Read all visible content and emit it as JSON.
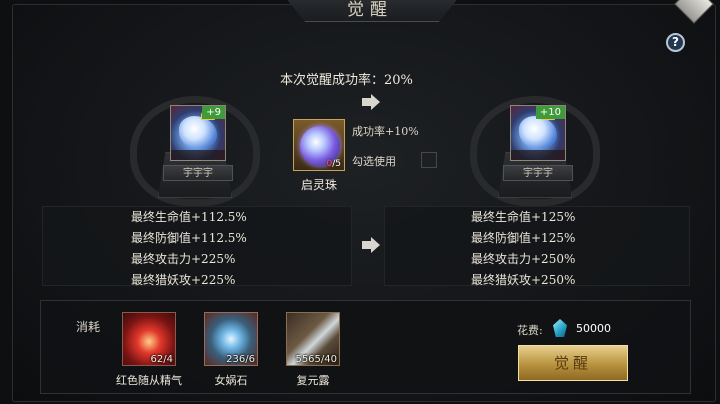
{
  "header": {
    "title": "觉醒",
    "help_icon": "question-icon",
    "help_label": "?"
  },
  "left_hero": {
    "name": "宇宇宇",
    "level_badge": "+9",
    "icon": "dragon-portrait-icon"
  },
  "right_hero": {
    "name": "宇宇宇",
    "level_badge": "+10",
    "icon": "dragon-portrait-icon"
  },
  "middle": {
    "success_rate": "本次觉醒成功率：20%",
    "item": {
      "name": "启灵珠",
      "count_owned": "0",
      "count_sep": "/5",
      "icon": "spirit-orb-icon"
    },
    "bonus": "成功率+10%",
    "use_checkbox_label": "勾选使用",
    "use_checked": false
  },
  "stats_before": [
    "最终生命值+112.5%",
    "最终防御值+112.5%",
    "最终攻击力+225%",
    "最终猎妖攻+225%"
  ],
  "stats_after": [
    "最终生命值+125%",
    "最终防御值+125%",
    "最终攻击力+250%",
    "最终猎妖攻+250%"
  ],
  "consume": {
    "label": "消耗",
    "materials": [
      {
        "name": "红色随从精气",
        "qty": "62/4",
        "icon": "red-essence-icon"
      },
      {
        "name": "女娲石",
        "qty": "236/6",
        "icon": "nuwa-stone-icon"
      },
      {
        "name": "复元露",
        "qty": "5565/40",
        "icon": "restore-dew-icon"
      }
    ]
  },
  "cost": {
    "label": "花费:",
    "value": "50000",
    "icon": "jade-gem-icon"
  },
  "action": {
    "awaken_label": "觉醒"
  }
}
